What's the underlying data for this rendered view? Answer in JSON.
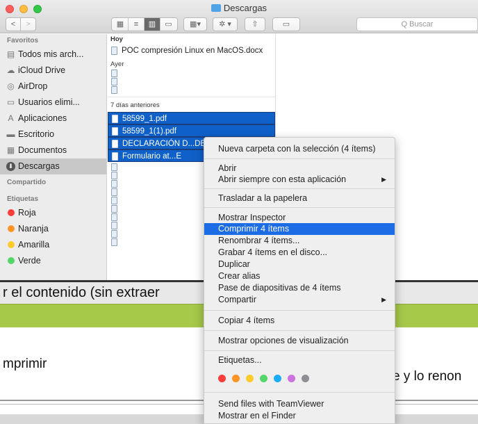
{
  "window": {
    "title": "Descargas"
  },
  "toolbar": {
    "back_icon": "chevron-left-icon",
    "forward_icon": "chevron-right-icon",
    "arrange_label": "▾",
    "action_label": "✲ ▾",
    "share_label": "⇧",
    "tag_label": "▭",
    "search_placeholder": "Q Buscar"
  },
  "sidebar": {
    "favorites_header": "Favoritos",
    "favorites": [
      {
        "label": "Todos mis arch...",
        "icon": "all-files-icon",
        "glyph": "▤"
      },
      {
        "label": "iCloud Drive",
        "icon": "cloud-icon",
        "glyph": "☁"
      },
      {
        "label": "AirDrop",
        "icon": "airdrop-icon",
        "glyph": "◎"
      },
      {
        "label": "Usuarios elimi...",
        "icon": "folder-icon",
        "glyph": "▭"
      },
      {
        "label": "Aplicaciones",
        "icon": "applications-icon",
        "glyph": "A"
      },
      {
        "label": "Escritorio",
        "icon": "desktop-icon",
        "glyph": "▬"
      },
      {
        "label": "Documentos",
        "icon": "documents-icon",
        "glyph": "▦"
      },
      {
        "label": "Descargas",
        "icon": "downloads-icon",
        "glyph": "⬇"
      }
    ],
    "shared_header": "Compartido",
    "tags_header": "Etiquetas",
    "tags": [
      {
        "label": "Roja",
        "color": "#fc3d39"
      },
      {
        "label": "Naranja",
        "color": "#fd9426"
      },
      {
        "label": "Amarilla",
        "color": "#fecb2e"
      },
      {
        "label": "Verde",
        "color": "#53d769"
      }
    ]
  },
  "files": {
    "today_header": "Hoy",
    "today": [
      "POC compresión Linux en MacOS.docx"
    ],
    "yesterday_header": "Ayer",
    "week_header": "7 días anteriores",
    "selected": [
      "58599_1.pdf",
      "58599_1(1).pdf",
      "DECLARACIÓN D...DE",
      "Formulario      at...E"
    ]
  },
  "context_menu": {
    "items": [
      {
        "label": "Nueva carpeta con la selección (4 ítems)"
      },
      {
        "label": "Abrir"
      },
      {
        "label": "Abrir siempre con esta aplicación",
        "submenu": "▶"
      },
      {
        "label": "Trasladar a la papelera"
      },
      {
        "label": "Mostrar Inspector"
      },
      {
        "label": "Comprimir 4 ítems"
      },
      {
        "label": "Renombrar 4 ítems..."
      },
      {
        "label": "Grabar 4 ítems en el disco..."
      },
      {
        "label": "Duplicar"
      },
      {
        "label": "Crear alias"
      },
      {
        "label": "Pase de diapositivas de 4 ítems"
      },
      {
        "label": "Compartir",
        "submenu": "▶"
      },
      {
        "label": "Copiar 4 ítems"
      },
      {
        "label": "Mostrar opciones de visualización"
      },
      {
        "label": "Etiquetas..."
      },
      {
        "label": "Send files with TeamViewer"
      },
      {
        "label": "Mostrar en el Finder"
      }
    ],
    "highlighted": "Comprimir 4 ítems",
    "tag_colors": [
      "#fc3d39",
      "#fd9426",
      "#fecb2e",
      "#53d769",
      "#1badf8",
      "#cc73e1",
      "#8e8e93"
    ]
  },
  "document": {
    "line1": "r el contenido (sin extraer",
    "line2": "mprimir",
    "line3": "e y lo renon"
  }
}
